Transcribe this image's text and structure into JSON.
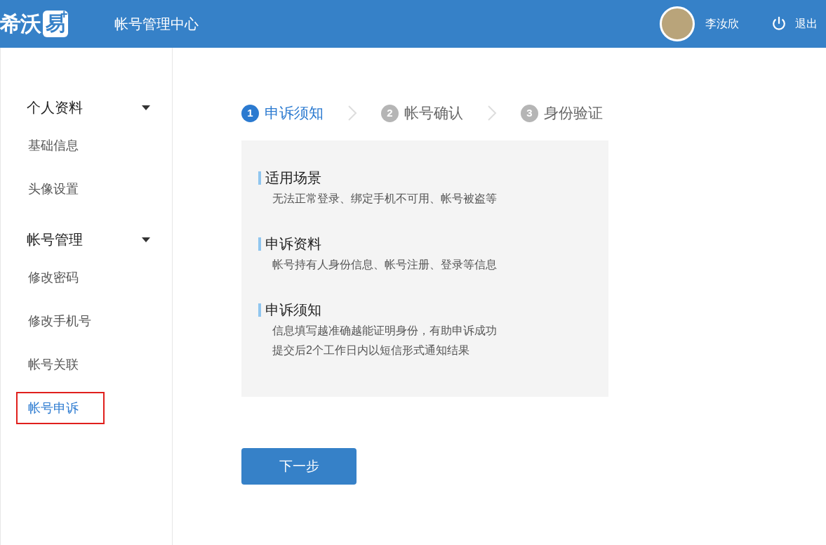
{
  "header": {
    "logo": {
      "text": "希沃",
      "boxed": "易",
      "plus": "+"
    },
    "title": "帐号管理中心",
    "user": {
      "name": "李汝欣"
    },
    "logout": "退出"
  },
  "sidebar": {
    "groups": [
      {
        "label": "个人资料",
        "expanded": true,
        "items": [
          {
            "label": "基础信息",
            "selected": false,
            "outlined": false
          },
          {
            "label": "头像设置",
            "selected": false,
            "outlined": false
          }
        ]
      },
      {
        "label": "帐号管理",
        "expanded": true,
        "items": [
          {
            "label": "修改密码",
            "selected": false,
            "outlined": false
          },
          {
            "label": "修改手机号",
            "selected": false,
            "outlined": false
          },
          {
            "label": "帐号关联",
            "selected": false,
            "outlined": false
          },
          {
            "label": "帐号申诉",
            "selected": true,
            "outlined": true
          }
        ]
      }
    ]
  },
  "steps": [
    {
      "number": "1",
      "label": "申诉须知",
      "selected": true
    },
    {
      "number": "2",
      "label": "帐号确认",
      "selected": false
    },
    {
      "number": "3",
      "label": "身份验证",
      "selected": false
    }
  ],
  "notice": [
    {
      "title": "适用场景",
      "lines": [
        "无法正常登录、绑定手机不可用、帐号被盗等"
      ]
    },
    {
      "title": "申诉资料",
      "lines": [
        "帐号持有人身份信息、帐号注册、登录等信息"
      ]
    },
    {
      "title": "申诉须知",
      "lines": [
        "信息填写越准确越能证明身份，有助申诉成功",
        "提交后2个工作日内以短信形式通知结果"
      ]
    }
  ],
  "next_button": "下一步"
}
